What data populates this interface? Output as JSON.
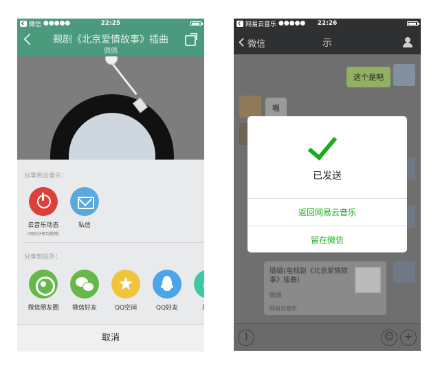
{
  "left_screen": {
    "status_bar": {
      "app": "微信",
      "signal": "●●●●●",
      "time": "22:25"
    },
    "header": {
      "title": "觋剧《北京爱情故事》插曲",
      "subtitle": "佩佩"
    },
    "share_to_app_label": "分享到云音乐：",
    "app_items": [
      {
        "label": "云音乐动态",
        "sublabel": "(同时分享到微博)",
        "icon": "netease-music-icon",
        "color": "#d9413a"
      },
      {
        "label": "私信",
        "icon": "mail-icon",
        "color": "#5aa9dd"
      }
    ],
    "share_external_label": "分享到站外：",
    "external_items": [
      {
        "label": "微信朋友圈",
        "icon": "moments-icon",
        "color": "#67b84a"
      },
      {
        "label": "微信好友",
        "icon": "wechat-icon",
        "color": "#67b84a"
      },
      {
        "label": "QQ空间",
        "icon": "qzone-icon",
        "color": "#f0c53c"
      },
      {
        "label": "QQ好友",
        "icon": "qq-icon",
        "color": "#4aa6e8"
      },
      {
        "label": "易信",
        "icon": "yixin-icon",
        "color": "#3ec7a3"
      }
    ],
    "cancel_label": "取消"
  },
  "right_screen": {
    "status_bar": {
      "app": "网易云音乐",
      "signal": "●●●●●",
      "time": "22:26"
    },
    "header": {
      "back_label": "微信",
      "title": "示"
    },
    "messages": [
      {
        "from": "me",
        "text": "这个是吧"
      },
      {
        "from": "other",
        "text": "嗯"
      }
    ],
    "card": {
      "title": "璐璐(电视剧《北京爱情故事》插曲)",
      "subtitle": "佩佩",
      "footer": "网易云音乐"
    },
    "dialog": {
      "title": "已发送",
      "buttons": [
        "返回网易云音乐",
        "留在微信"
      ],
      "accent": "#1aad19"
    }
  }
}
